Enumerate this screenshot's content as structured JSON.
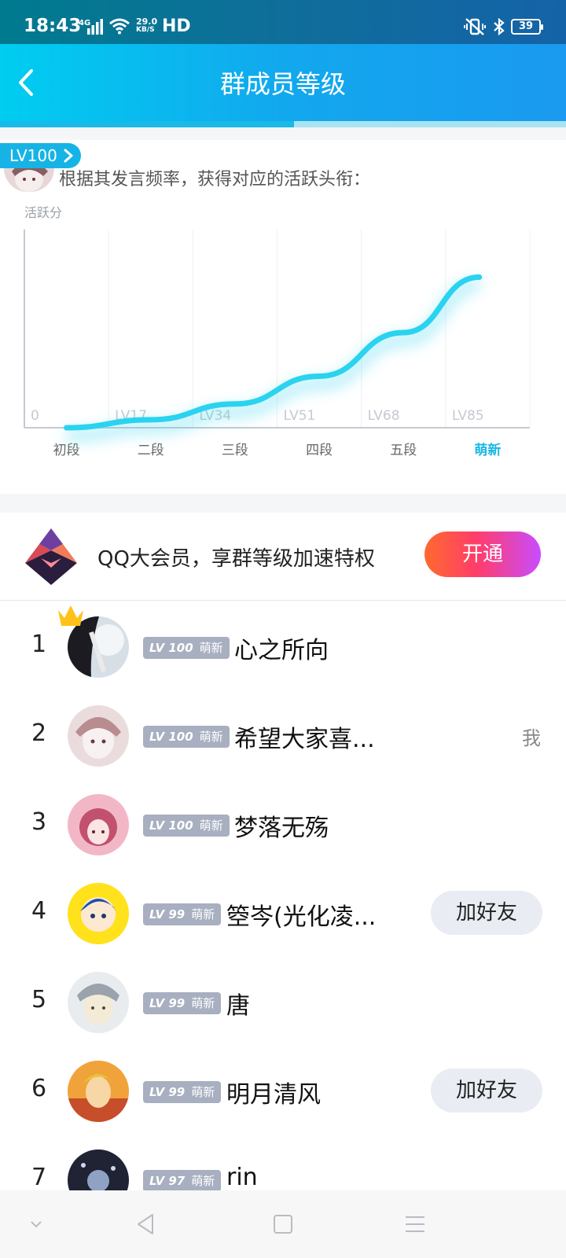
{
  "status_bar": {
    "time": "18:43",
    "network": "4G",
    "speed_value": "29.0",
    "speed_unit": "KB/S",
    "hd": "HD",
    "battery": "39"
  },
  "header": {
    "title": "群成员等级",
    "back_icon": "chevron-left-icon"
  },
  "chart_card": {
    "level_badge": "LV100",
    "description": "根据其发言频率，获得对应的活跃头衔：",
    "chart_data": {
      "type": "line",
      "ylabel": "活跃分",
      "tick_labels": [
        "0",
        "LV17",
        "LV34",
        "LV51",
        "LV68",
        "LV85"
      ],
      "categories": [
        "初段",
        "二段",
        "三段",
        "四段",
        "五段",
        "萌新"
      ],
      "highlighted_category": "萌新",
      "curve": [
        {
          "x": 0.5,
          "y": 0
        },
        {
          "x": 1.5,
          "y": 4
        },
        {
          "x": 2.5,
          "y": 12
        },
        {
          "x": 3.5,
          "y": 26
        },
        {
          "x": 4.5,
          "y": 48
        },
        {
          "x": 5.4,
          "y": 76
        }
      ],
      "ylim": [
        0,
        100
      ],
      "grid": "vertical",
      "colors": {
        "line": "#2ad3ef",
        "axis": "#c5c9d2",
        "grid": "#eef0f3",
        "highlight": "#1ab8e4"
      }
    }
  },
  "vip": {
    "icon": "qq-vip-diamond-icon",
    "text": "QQ大会员，享群等级加速特权",
    "button": "开通"
  },
  "ranking": [
    {
      "rank": "1",
      "level": "LV 100",
      "title": "萌新",
      "name": "心之所向",
      "action": "",
      "crown": true
    },
    {
      "rank": "2",
      "level": "LV 100",
      "title": "萌新",
      "name": "希望大家喜...",
      "action": "我",
      "crown": false
    },
    {
      "rank": "3",
      "level": "LV 100",
      "title": "萌新",
      "name": "梦落无殇",
      "action": "",
      "crown": false
    },
    {
      "rank": "4",
      "level": "LV 99",
      "title": "萌新",
      "name": "箜岑(光化凌...",
      "action": "加好友",
      "crown": false
    },
    {
      "rank": "5",
      "level": "LV 99",
      "title": "萌新",
      "name": "唐",
      "action": "",
      "crown": false
    },
    {
      "rank": "6",
      "level": "LV 99",
      "title": "萌新",
      "name": "明月清风",
      "action": "加好友",
      "crown": false
    },
    {
      "rank": "7",
      "level": "LV 97",
      "title": "萌新",
      "name": "rin",
      "action": "",
      "crown": false
    }
  ],
  "nav": {
    "items": [
      "chevron-down-icon",
      "back-triangle-icon",
      "home-square-icon",
      "menu-lines-icon"
    ]
  }
}
